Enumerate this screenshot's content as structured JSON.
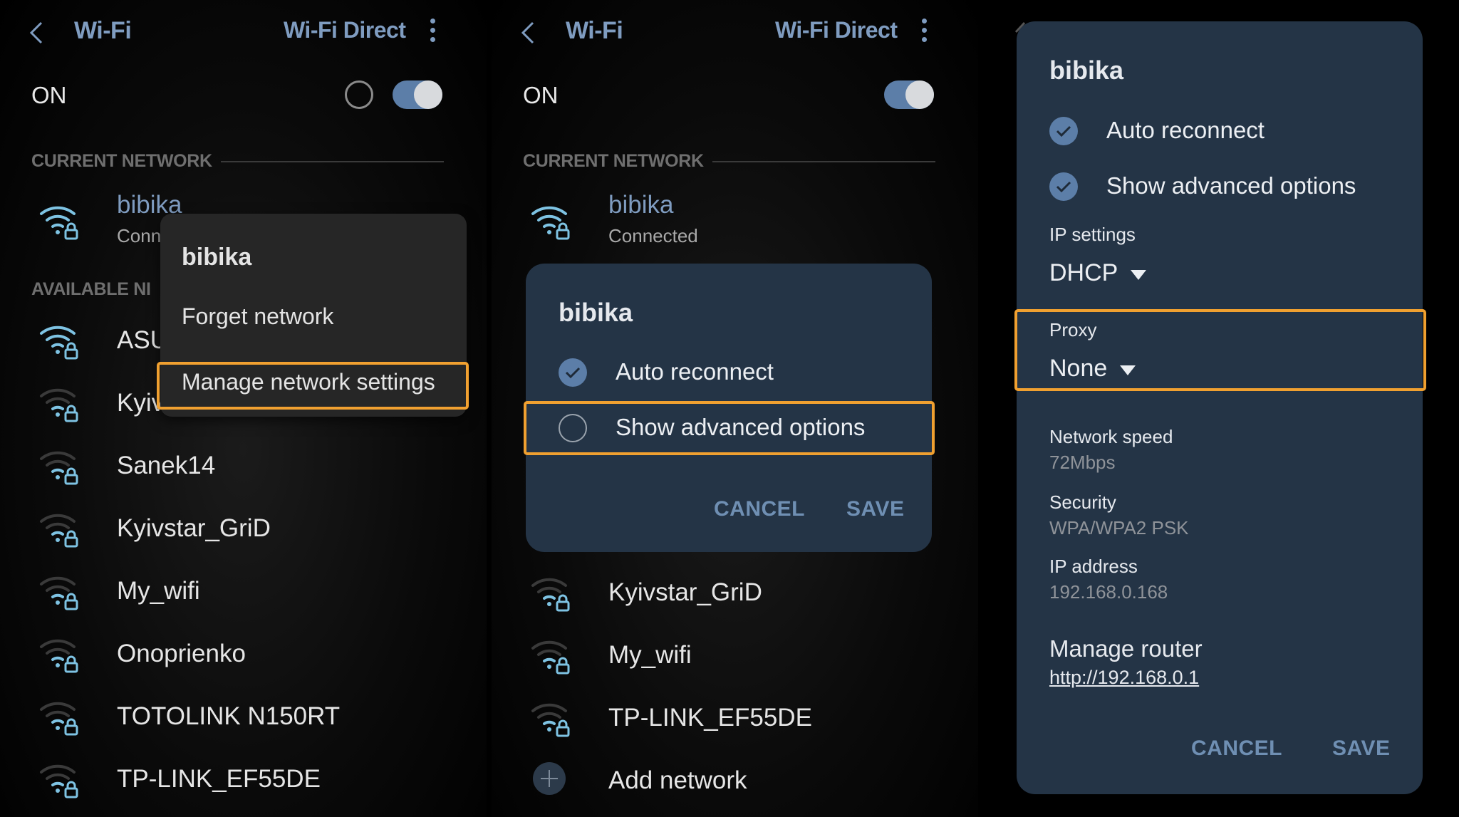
{
  "colors": {
    "accent": "#7f9cc0",
    "toggle_on": "#5c7ea8",
    "dialog_bg": "#243446",
    "menu_bg": "#262626",
    "highlight": "#f0a030",
    "background": "#000000"
  },
  "panel1": {
    "header": {
      "back_icon": "chevron-left-icon",
      "title": "Wi-Fi",
      "wifi_direct": "Wi-Fi Direct",
      "more_icon": "more-vert-icon"
    },
    "power": {
      "label": "ON",
      "toggle_on": true
    },
    "current_section": "CURRENT NETWORK",
    "current_network": {
      "name": "bibika",
      "status": "Conn"
    },
    "available_section": "AVAILABLE NI",
    "networks": [
      "ASU",
      "Kyiv",
      "Sanek14",
      "Kyivstar_GriD",
      "My_wifi",
      "Onoprienko",
      "TOTOLINK N150RT",
      "TP-LINK_EF55DE"
    ],
    "context_menu": {
      "title": "bibika",
      "items": [
        "Forget network",
        "Manage network settings"
      ],
      "highlighted": "Manage network settings"
    }
  },
  "panel2": {
    "header": {
      "back_icon": "chevron-left-icon",
      "title": "Wi-Fi",
      "wifi_direct": "Wi-Fi Direct",
      "more_icon": "more-vert-icon"
    },
    "power": {
      "label": "ON",
      "toggle_on": true
    },
    "current_section": "CURRENT NETWORK",
    "current_network": {
      "name": "bibika",
      "status": "Connected"
    },
    "networks": [
      "Kyivstar_GriD",
      "My_wifi",
      "TP-LINK_EF55DE"
    ],
    "add_network": "Add network",
    "dialog": {
      "title": "bibika",
      "options": [
        {
          "label": "Auto reconnect",
          "checked": true
        },
        {
          "label": "Show advanced options",
          "checked": false
        }
      ],
      "highlighted": "Show advanced options",
      "cancel": "CANCEL",
      "save": "SAVE"
    }
  },
  "panel3": {
    "dialog": {
      "title": "bibika",
      "options": [
        {
          "label": "Auto reconnect",
          "checked": true
        },
        {
          "label": "Show advanced options",
          "checked": true
        }
      ],
      "ip_settings": {
        "label": "IP settings",
        "value": "DHCP"
      },
      "proxy": {
        "label": "Proxy",
        "value": "None"
      },
      "highlighted": "Proxy",
      "network_speed": {
        "label": "Network speed",
        "value": "72Mbps"
      },
      "security": {
        "label": "Security",
        "value": "WPA/WPA2 PSK"
      },
      "ip_address": {
        "label": "IP address",
        "value": "192.168.0.168"
      },
      "manage_router": {
        "label": "Manage router",
        "link": "http://192.168.0.1"
      },
      "cancel": "CANCEL",
      "save": "SAVE"
    }
  }
}
